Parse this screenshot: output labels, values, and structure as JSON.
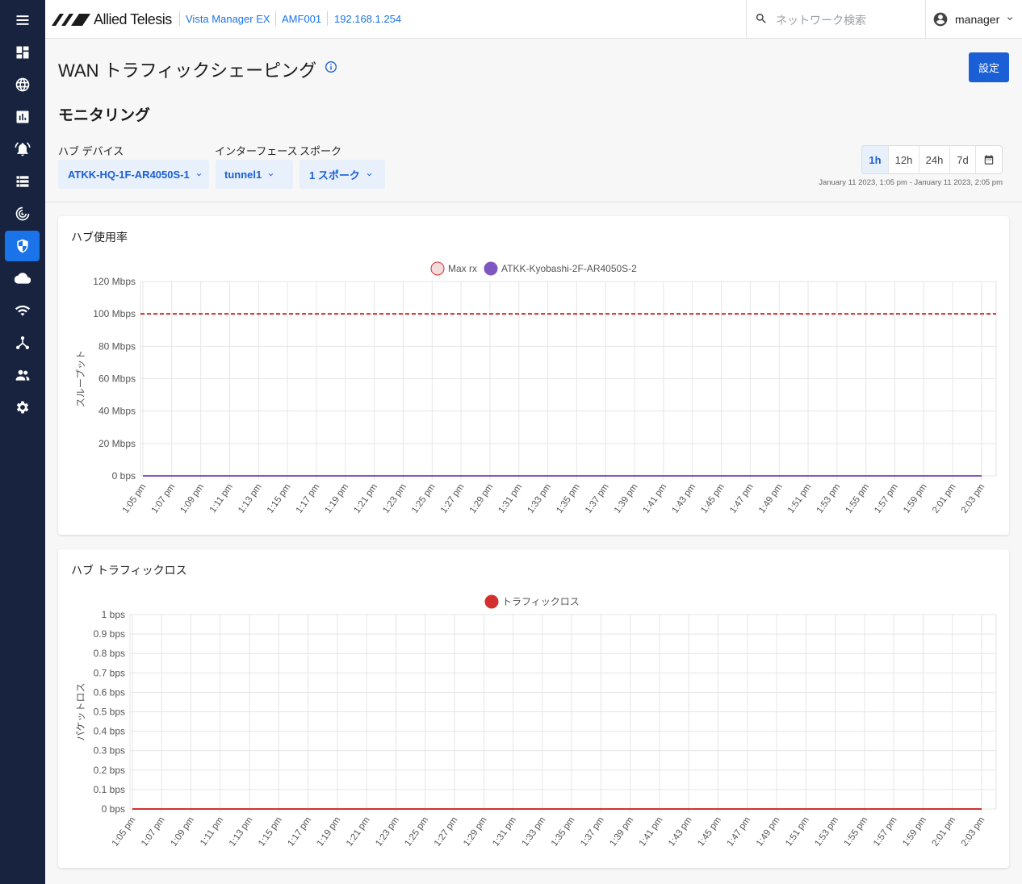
{
  "brand": {
    "logo_text": "Allied Telesis"
  },
  "breadcrumb": [
    "Vista Manager EX",
    "AMF001",
    "192.168.1.254"
  ],
  "search": {
    "placeholder": "ネットワーク検索"
  },
  "user": {
    "name": "manager"
  },
  "sidebar": {
    "items": [
      {
        "icon": "menu-icon",
        "active": false
      },
      {
        "icon": "dashboard-icon",
        "active": false
      },
      {
        "icon": "globe-icon",
        "active": false
      },
      {
        "icon": "bar-chart-icon",
        "active": false
      },
      {
        "icon": "alarm-icon",
        "active": false
      },
      {
        "icon": "list-icon",
        "active": false
      },
      {
        "icon": "radar-icon",
        "active": false
      },
      {
        "icon": "shield-icon",
        "active": true
      },
      {
        "icon": "cloud-icon",
        "active": false
      },
      {
        "icon": "wifi-icon",
        "active": false
      },
      {
        "icon": "topology-icon",
        "active": false
      },
      {
        "icon": "users-icon",
        "active": false
      },
      {
        "icon": "gear-icon",
        "active": false
      }
    ]
  },
  "page": {
    "title": "WAN トラフィックシェーピング",
    "settings_label": "設定",
    "section_title": "モニタリング"
  },
  "filters": {
    "hub_device": {
      "label": "ハブ デバイス",
      "value": "ATKK-HQ-1F-AR4050S-1"
    },
    "interface": {
      "label": "インターフェース",
      "value": "tunnel1"
    },
    "spoke": {
      "label": "スポーク",
      "value": "1 スポーク"
    }
  },
  "time_range": {
    "options": [
      "1h",
      "12h",
      "24h",
      "7d"
    ],
    "selected": "1h",
    "calendar_icon": "calendar-icon",
    "text": "January 11 2023, 1:05 pm - January 11 2023, 2:05 pm"
  },
  "colors": {
    "accent": "#1a5fd6",
    "sidebar": "#17233f",
    "max_rx": "#d32f2f",
    "series_purple": "#7e57c2",
    "traffic_loss": "#d32f2f"
  },
  "chart_data": [
    {
      "type": "line",
      "title": "ハブ使用率",
      "ylabel": "スループット",
      "xlabel": "",
      "x": [
        "1:05 pm",
        "1:07 pm",
        "1:09 pm",
        "1:11 pm",
        "1:13 pm",
        "1:15 pm",
        "1:17 pm",
        "1:19 pm",
        "1:21 pm",
        "1:23 pm",
        "1:25 pm",
        "1:27 pm",
        "1:29 pm",
        "1:31 pm",
        "1:33 pm",
        "1:35 pm",
        "1:37 pm",
        "1:39 pm",
        "1:41 pm",
        "1:43 pm",
        "1:45 pm",
        "1:47 pm",
        "1:49 pm",
        "1:51 pm",
        "1:53 pm",
        "1:55 pm",
        "1:57 pm",
        "1:59 pm",
        "2:01 pm",
        "2:03 pm"
      ],
      "y_ticks": [
        "0 bps",
        "20 Mbps",
        "40 Mbps",
        "60 Mbps",
        "80 Mbps",
        "100 Mbps",
        "120 Mbps"
      ],
      "ylim": [
        0,
        120
      ],
      "y_unit": "Mbps",
      "grid": true,
      "legend": "top-center",
      "series": [
        {
          "name": "Max rx",
          "style": "dashed",
          "color": "#d32f2f",
          "values": [
            100,
            100,
            100,
            100,
            100,
            100,
            100,
            100,
            100,
            100,
            100,
            100,
            100,
            100,
            100,
            100,
            100,
            100,
            100,
            100,
            100,
            100,
            100,
            100,
            100,
            100,
            100,
            100,
            100,
            100
          ]
        },
        {
          "name": "ATKK-Kyobashi-2F-AR4050S-2",
          "style": "solid",
          "color": "#7e57c2",
          "values": [
            0,
            0,
            0,
            0,
            0,
            0,
            0,
            0,
            0,
            0,
            0,
            0,
            0,
            0,
            0,
            0,
            0,
            0,
            0,
            0,
            0,
            0,
            0,
            0,
            0,
            0,
            0,
            0,
            0,
            0
          ]
        }
      ]
    },
    {
      "type": "line",
      "title": "ハブ トラフィックロス",
      "ylabel": "パケットロス",
      "xlabel": "",
      "x": [
        "1:05 pm",
        "1:07 pm",
        "1:09 pm",
        "1:11 pm",
        "1:13 pm",
        "1:15 pm",
        "1:17 pm",
        "1:19 pm",
        "1:21 pm",
        "1:23 pm",
        "1:25 pm",
        "1:27 pm",
        "1:29 pm",
        "1:31 pm",
        "1:33 pm",
        "1:35 pm",
        "1:37 pm",
        "1:39 pm",
        "1:41 pm",
        "1:43 pm",
        "1:45 pm",
        "1:47 pm",
        "1:49 pm",
        "1:51 pm",
        "1:53 pm",
        "1:55 pm",
        "1:57 pm",
        "1:59 pm",
        "2:01 pm",
        "2:03 pm"
      ],
      "y_ticks": [
        "0 bps",
        "0.1 bps",
        "0.2 bps",
        "0.3 bps",
        "0.4 bps",
        "0.5 bps",
        "0.6 bps",
        "0.7 bps",
        "0.8 bps",
        "0.9 bps",
        "1 bps"
      ],
      "ylim": [
        0,
        1
      ],
      "y_unit": "bps",
      "grid": true,
      "legend": "top-center",
      "series": [
        {
          "name": "トラフィックロス",
          "style": "solid",
          "color": "#d32f2f",
          "values": [
            0,
            0,
            0,
            0,
            0,
            0,
            0,
            0,
            0,
            0,
            0,
            0,
            0,
            0,
            0,
            0,
            0,
            0,
            0,
            0,
            0,
            0,
            0,
            0,
            0,
            0,
            0,
            0,
            0,
            0
          ]
        }
      ]
    }
  ]
}
